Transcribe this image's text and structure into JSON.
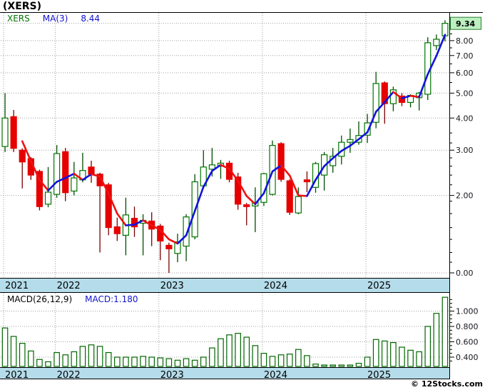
{
  "title": "(XERS)",
  "watermark": "© 12Stocks.com",
  "colors": {
    "up": "#007500",
    "up_wick": "#004d00",
    "down": "#e60000",
    "down_wick": "#7a0000",
    "ma_up": "#1212dd",
    "ma_down": "#ee1111",
    "band_bg": "#b5dcea",
    "grid": "#a0a0a0",
    "border": "#000000",
    "axis_text": "#16161d",
    "last_price_bg": "#bdefc0",
    "last_price_border": "#2e7d32",
    "macd_bar": "#006600",
    "legend_symbol": "#007500",
    "legend_blue": "#1212cc",
    "legend_black": "#000000"
  },
  "chart_data": [
    {
      "type": "candlestick",
      "symbol": "XERS",
      "title": "(XERS)",
      "legend": [
        {
          "text": "XERS",
          "color_key": "legend_symbol"
        },
        {
          "text": "MA(3)",
          "color_key": "legend_blue"
        },
        {
          "text": "8.44",
          "color_key": "legend_blue"
        }
      ],
      "x_unit": "month",
      "years": [
        {
          "label": "2021",
          "start_index": 0
        },
        {
          "label": "2022",
          "start_index": 6
        },
        {
          "label": "2023",
          "start_index": 18
        },
        {
          "label": "2024",
          "start_index": 30
        },
        {
          "label": "2025",
          "start_index": 42
        }
      ],
      "y_axis": {
        "scale": "log",
        "labels": [
          {
            "text": "8.00",
            "value": 8.0
          },
          {
            "text": "7.00",
            "value": 7.0
          },
          {
            "text": "6.00",
            "value": 6.0
          },
          {
            "text": "5.00",
            "value": 5.0
          },
          {
            "text": "4.00",
            "value": 4.0
          },
          {
            "text": "3.00",
            "value": 3.0
          },
          {
            "text": "2.00",
            "value": 2.0
          },
          {
            "text": "0.00",
            "value": 1.0
          }
        ]
      },
      "last_price": {
        "text": "9.34",
        "value": 9.34
      },
      "ohlc": [
        [
          3.1,
          5.0,
          2.95,
          4.0
        ],
        [
          4.05,
          4.3,
          2.95,
          3.05
        ],
        [
          3.0,
          3.05,
          2.13,
          2.7
        ],
        [
          2.78,
          2.82,
          2.3,
          2.4
        ],
        [
          2.48,
          2.52,
          1.75,
          1.81
        ],
        [
          1.85,
          2.58,
          1.8,
          2.06
        ],
        [
          2.02,
          3.14,
          1.96,
          2.91
        ],
        [
          2.96,
          3.06,
          1.9,
          2.05
        ],
        [
          2.08,
          2.7,
          2.0,
          2.34
        ],
        [
          2.3,
          2.93,
          2.25,
          2.5
        ],
        [
          2.58,
          2.73,
          2.24,
          2.42
        ],
        [
          2.42,
          2.45,
          1.2,
          2.18
        ],
        [
          2.2,
          2.24,
          1.4,
          1.5
        ],
        [
          1.51,
          1.64,
          1.33,
          1.42
        ],
        [
          1.4,
          1.96,
          1.17,
          1.68
        ],
        [
          1.63,
          1.81,
          1.38,
          1.51
        ],
        [
          1.56,
          1.69,
          1.17,
          1.6
        ],
        [
          1.59,
          1.72,
          1.27,
          1.48
        ],
        [
          1.52,
          1.55,
          1.12,
          1.33
        ],
        [
          1.28,
          1.31,
          1.0,
          1.24
        ],
        [
          1.19,
          1.42,
          1.1,
          1.32
        ],
        [
          1.27,
          1.69,
          1.11,
          1.65
        ],
        [
          1.38,
          2.42,
          1.35,
          2.26
        ],
        [
          2.18,
          3.0,
          2.13,
          2.58
        ],
        [
          2.53,
          3.06,
          2.37,
          2.63
        ],
        [
          2.6,
          2.75,
          2.32,
          2.67
        ],
        [
          2.67,
          2.73,
          2.25,
          2.31
        ],
        [
          2.36,
          2.45,
          1.76,
          1.85
        ],
        [
          1.84,
          1.87,
          1.53,
          1.81
        ],
        [
          1.82,
          2.15,
          1.44,
          1.88
        ],
        [
          1.88,
          2.45,
          1.82,
          2.43
        ],
        [
          2.02,
          3.27,
          2.0,
          3.13
        ],
        [
          3.18,
          3.22,
          2.26,
          2.31
        ],
        [
          2.28,
          2.31,
          1.68,
          1.72
        ],
        [
          1.71,
          2.15,
          1.69,
          1.98
        ],
        [
          2.3,
          2.48,
          2.06,
          2.26
        ],
        [
          2.15,
          2.7,
          2.05,
          2.66
        ],
        [
          2.4,
          2.95,
          2.09,
          2.88
        ],
        [
          2.61,
          3.06,
          2.45,
          2.84
        ],
        [
          2.84,
          3.42,
          2.64,
          3.22
        ],
        [
          3.22,
          3.64,
          2.93,
          3.3
        ],
        [
          3.22,
          3.88,
          3.15,
          3.42
        ],
        [
          3.43,
          4.15,
          3.2,
          3.83
        ],
        [
          3.85,
          6.05,
          3.65,
          5.45
        ],
        [
          5.48,
          5.55,
          3.8,
          4.55
        ],
        [
          4.55,
          5.3,
          4.25,
          5.15
        ],
        [
          4.87,
          5.0,
          4.45,
          4.6
        ],
        [
          4.6,
          4.95,
          4.4,
          4.9
        ],
        [
          4.8,
          5.05,
          4.28,
          5.0
        ],
        [
          4.95,
          8.25,
          4.7,
          7.85
        ],
        [
          7.65,
          8.45,
          7.35,
          8.1
        ],
        [
          8.35,
          9.6,
          7.95,
          9.34
        ]
      ],
      "ma3": [
        null,
        null,
        3.25,
        2.72,
        2.3,
        2.09,
        2.26,
        2.34,
        2.43,
        2.3,
        2.42,
        2.37,
        2.03,
        1.7,
        1.53,
        1.54,
        1.6,
        1.53,
        1.47,
        1.35,
        1.3,
        1.4,
        1.74,
        2.16,
        2.49,
        2.63,
        2.54,
        2.28,
        1.99,
        1.85,
        2.04,
        2.48,
        2.62,
        2.39,
        2.0,
        1.99,
        2.3,
        2.6,
        2.79,
        2.98,
        3.12,
        3.31,
        3.52,
        4.23,
        4.61,
        5.05,
        4.77,
        4.88,
        4.83,
        5.92,
        6.98,
        8.43
      ]
    },
    {
      "type": "bar",
      "name": "MACD",
      "legend": [
        {
          "text": "MACD(26,12,9)",
          "color_key": "legend_black"
        },
        {
          "text": "MACD:1.180",
          "color_key": "legend_blue"
        }
      ],
      "values": [
        0.78,
        0.67,
        0.58,
        0.48,
        0.37,
        0.34,
        0.46,
        0.43,
        0.47,
        0.54,
        0.56,
        0.54,
        0.46,
        0.4,
        0.4,
        0.4,
        0.41,
        0.4,
        0.39,
        0.38,
        0.36,
        0.38,
        0.36,
        0.4,
        0.52,
        0.64,
        0.69,
        0.71,
        0.66,
        0.55,
        0.45,
        0.41,
        0.43,
        0.44,
        0.5,
        0.42,
        0.31,
        0.29,
        0.27,
        0.27,
        0.29,
        0.32,
        0.4,
        0.63,
        0.61,
        0.59,
        0.53,
        0.49,
        0.47,
        0.8,
        0.97,
        1.18
      ],
      "y_axis": {
        "labels": [
          {
            "text": "1.000",
            "value": 1.0
          },
          {
            "text": "0.800",
            "value": 0.8
          },
          {
            "text": "0.600",
            "value": 0.6
          },
          {
            "text": "0.400",
            "value": 0.4
          }
        ]
      },
      "ylim": [
        0.26,
        1.25
      ]
    }
  ]
}
